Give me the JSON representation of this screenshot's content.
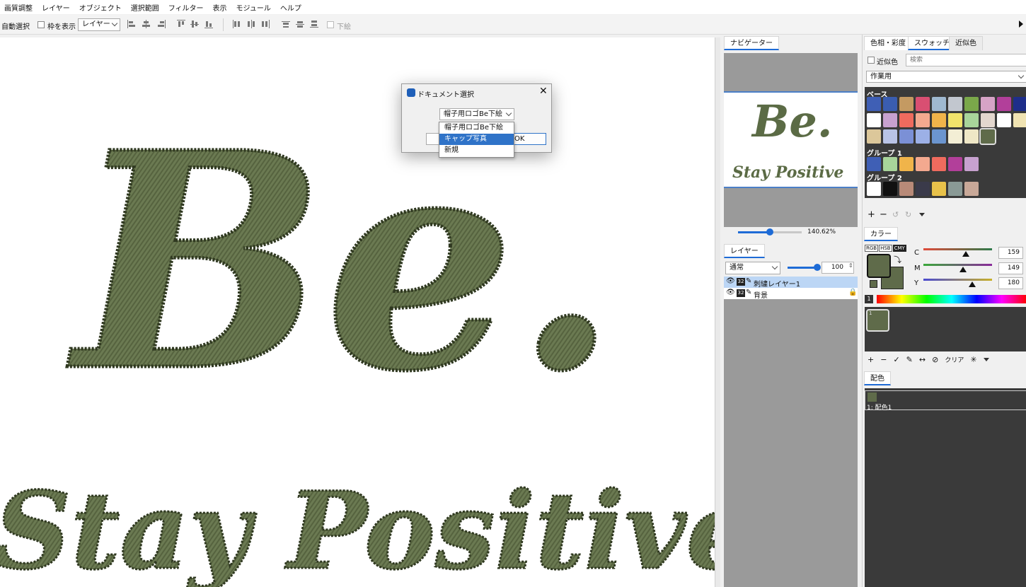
{
  "menubar": {
    "items": [
      "画質調整",
      "レイヤー",
      "オブジェクト",
      "選択範囲",
      "フィルター",
      "表示",
      "モジュール",
      "ヘルプ"
    ]
  },
  "toolbar": {
    "auto_select_label": "自動選択",
    "show_frame_label": "枠を表示",
    "target_select_value": "レイヤー",
    "bottom_label": "下絵"
  },
  "canvas": {
    "logo_text": "Be.",
    "tagline_text": "Stay Positive",
    "thread_color": "#6b7a52"
  },
  "navigator": {
    "tab_label": "ナビゲーター",
    "preview_logo": "Be.",
    "preview_tagline": "Stay Positive",
    "zoom_label": "140.62%",
    "zoom_fraction": 0.5
  },
  "layers": {
    "tab_label": "レイヤー",
    "blend_mode": "通常",
    "opacity": "100",
    "opacity_fraction": 1.0,
    "items": [
      {
        "bits": "32",
        "name": "刺繍レイヤー1",
        "selected": true,
        "locked": false
      },
      {
        "bits": "32",
        "name": "背景",
        "selected": false,
        "locked": true
      }
    ]
  },
  "swatch_panel": {
    "tabs": [
      "色相・彩度",
      "スウォッチ",
      "近似色"
    ],
    "active_tab": 1,
    "approx_label": "近似色",
    "search_placeholder": "検索",
    "set_select_value": "作業用",
    "groups": [
      {
        "name": "ベース",
        "colors": [
          "#3f5fb5",
          "#3a5db0",
          "#c49a62",
          "#d94f72",
          "#9fb9d0",
          "#c2c7cf",
          "#7aa84a",
          "#d6a3c6",
          "#b23f9a",
          "#1e2e8a",
          "#ffffff",
          "#c7a1cf",
          "#ef6b5e",
          "#f3a98f",
          "#f0b44a",
          "#f1e36b",
          "#a8d49a",
          "#e3d7ce",
          "#ffffff",
          "#f0e3b2",
          "#dcc79a",
          "#b9c3e6",
          "#7b90d6",
          "#9cb0e6",
          "#6b95cf",
          "#f3eed5",
          "#efe7c6",
          "#5f6b4a"
        ]
      },
      {
        "name": "グループ 1",
        "colors": [
          "#3f5fb5",
          "#a8d49a",
          "#f0b44a",
          "#f3a98f",
          "#ef6b5e",
          "#b23f9a",
          "#c7a1cf"
        ]
      },
      {
        "name": "グループ 2",
        "colors": [
          "#ffffff",
          "#111111",
          "#b88a78",
          "#3a3a4a",
          "#e8c24a",
          "#8a9a96",
          "#c8a898"
        ]
      }
    ]
  },
  "color_panel": {
    "tab_label": "カラー",
    "modes": [
      "RGB",
      "HSB",
      "CMY"
    ],
    "active_mode": "CMY",
    "channels": [
      {
        "label": "C",
        "value": "159",
        "fraction": 0.62
      },
      {
        "label": "M",
        "value": "149",
        "fraction": 0.58
      },
      {
        "label": "Y",
        "value": "180",
        "fraction": 0.71
      }
    ],
    "foreground": "#5f6b4a",
    "background": "#5f6b4a",
    "history_index": "1",
    "slot_index": "1",
    "clear_label": "クリア"
  },
  "haisyoku": {
    "tab_label": "配色",
    "item_label": "1: 配色1",
    "item_color": "#5f6b4a"
  },
  "dialog": {
    "title": "ドキュメント選択",
    "selected_value": "帽子用ロゴBe下絵",
    "options": [
      "帽子用ロゴBe下絵",
      "キャップ写真",
      "新規"
    ],
    "highlighted_option": 1,
    "ok_label": "OK"
  }
}
